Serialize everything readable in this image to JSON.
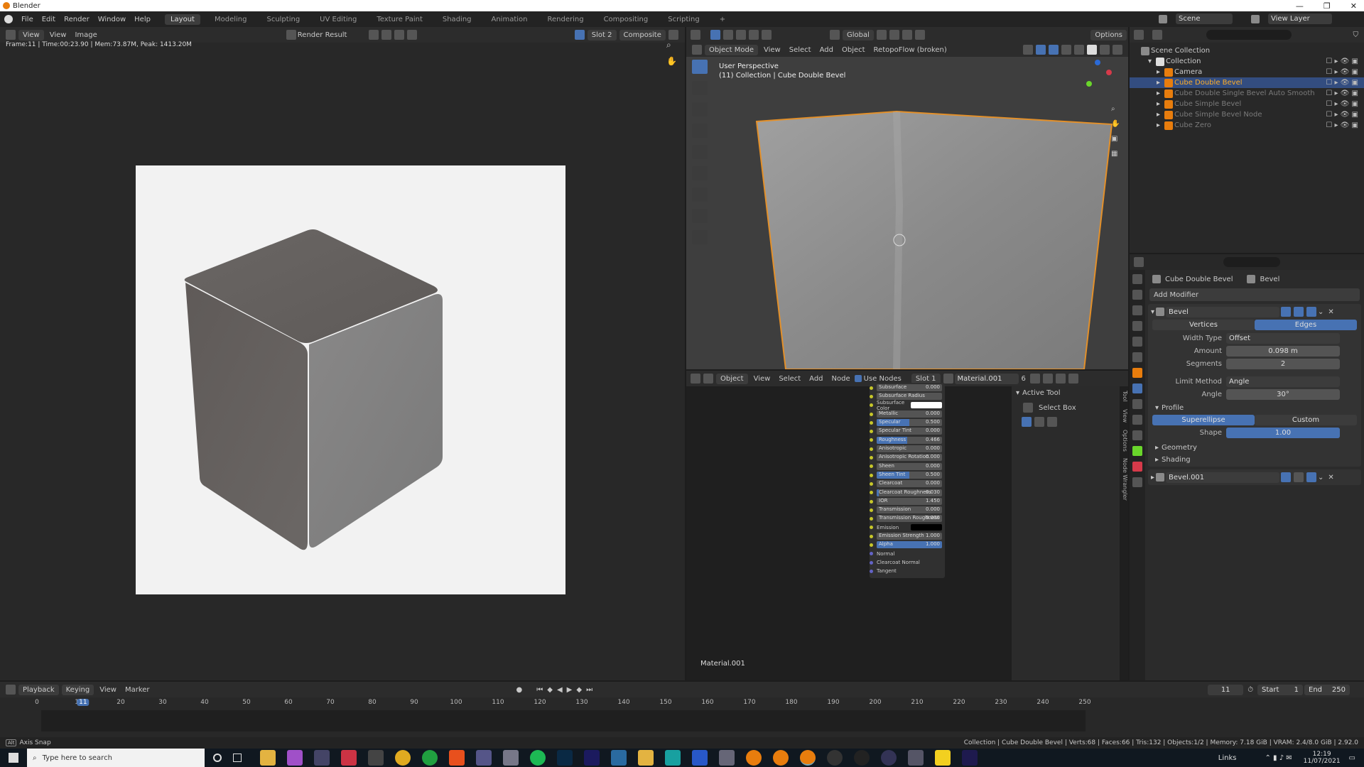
{
  "window": {
    "title": "Blender"
  },
  "menus": [
    "File",
    "Edit",
    "Render",
    "Window",
    "Help"
  ],
  "workspaces": [
    "Layout",
    "Modeling",
    "Sculpting",
    "UV Editing",
    "Texture Paint",
    "Shading",
    "Animation",
    "Rendering",
    "Compositing",
    "Scripting"
  ],
  "top_right": {
    "scene": "Scene",
    "view_layer": "View Layer"
  },
  "image_editor": {
    "view": "View",
    "view2": "View",
    "image": "Image",
    "image_name": "Render Result",
    "slot": "Slot 2",
    "composite": "Composite",
    "stats": "Frame:11 | Time:00:23.90 | Mem:73.87M, Peak: 1413.20M"
  },
  "viewport": {
    "mode": "Object Mode",
    "menu": [
      "View",
      "Select",
      "Add",
      "Object"
    ],
    "retopo": "RetopoFlow (broken)",
    "orientation": "Global",
    "options": "Options",
    "persp": "User Perspective",
    "collection_info": "(11) Collection | Cube Double Bevel"
  },
  "node_editor": {
    "object": "Object",
    "menu": [
      "View",
      "Select",
      "Add",
      "Node"
    ],
    "use_nodes": "Use Nodes",
    "slot": "Slot 1",
    "material": "Material.001",
    "users": "6",
    "material_label": "Material.001"
  },
  "node_rows": [
    {
      "name": "Subsurface",
      "value": "0.000",
      "fill": 0
    },
    {
      "name": "Subsurface Radius",
      "value": "",
      "fill": 0,
      "dropdown": true
    },
    {
      "name": "Subsurface Color",
      "value": "",
      "color": "#ffffff"
    },
    {
      "name": "Metallic",
      "value": "0.000",
      "fill": 0
    },
    {
      "name": "Specular",
      "value": "0.500",
      "fill": 0.5
    },
    {
      "name": "Specular Tint",
      "value": "0.000",
      "fill": 0
    },
    {
      "name": "Roughness",
      "value": "0.466",
      "fill": 0.466
    },
    {
      "name": "Anisotropic",
      "value": "0.000",
      "fill": 0
    },
    {
      "name": "Anisotropic Rotation",
      "value": "0.000",
      "fill": 0
    },
    {
      "name": "Sheen",
      "value": "0.000",
      "fill": 0
    },
    {
      "name": "Sheen Tint",
      "value": "0.500",
      "fill": 0.5
    },
    {
      "name": "Clearcoat",
      "value": "0.000",
      "fill": 0
    },
    {
      "name": "Clearcoat Roughness",
      "value": "0.030",
      "fill": 0.03
    },
    {
      "name": "IOR",
      "value": "1.450",
      "fill": 0
    },
    {
      "name": "Transmission",
      "value": "0.000",
      "fill": 0
    },
    {
      "name": "Transmission Roughness",
      "value": "0.000",
      "fill": 0
    },
    {
      "name": "Emission",
      "value": "",
      "color": "#000000"
    },
    {
      "name": "Emission Strength",
      "value": "1.000",
      "fill": 0
    },
    {
      "name": "Alpha",
      "value": "1.000",
      "fill": 1
    },
    {
      "name": "Normal",
      "value": "",
      "plain": true
    },
    {
      "name": "Clearcoat Normal",
      "value": "",
      "plain": true
    },
    {
      "name": "Tangent",
      "value": "",
      "plain": true
    }
  ],
  "sidebar": {
    "active_tool": "Active Tool",
    "select_box": "Select Box",
    "tabs": [
      "Tool",
      "View",
      "Options",
      "Node Wrangler"
    ]
  },
  "outliner": {
    "root": "Scene Collection",
    "items": [
      {
        "name": "Collection",
        "indent": 1
      },
      {
        "name": "Camera",
        "indent": 2
      },
      {
        "name": "Cube Double Bevel",
        "indent": 2,
        "selected": true
      },
      {
        "name": "Cube Double Single Bevel Auto Smooth",
        "indent": 2,
        "dim": true
      },
      {
        "name": "Cube Simple Bevel",
        "indent": 2,
        "dim": true
      },
      {
        "name": "Cube Simple Bevel Node",
        "indent": 2,
        "dim": true
      },
      {
        "name": "Cube Zero",
        "indent": 2,
        "dim": true
      }
    ]
  },
  "properties": {
    "object": "Cube Double Bevel",
    "modifier_icon": "Bevel",
    "add_modifier": "Add Modifier",
    "mod1": "Bevel",
    "vertices": "Vertices",
    "edges": "Edges",
    "width_type_label": "Width Type",
    "width_type": "Offset",
    "amount_label": "Amount",
    "amount": "0.098 m",
    "segments_label": "Segments",
    "segments": "2",
    "limit_method_label": "Limit Method",
    "limit_method": "Angle",
    "angle_label": "Angle",
    "angle": "30°",
    "profile": "Profile",
    "superellipse": "Superellipse",
    "custom": "Custom",
    "shape_label": "Shape",
    "shape": "1.00",
    "shape_fill": 1.0,
    "geometry": "Geometry",
    "shading": "Shading",
    "mod2": "Bevel.001"
  },
  "timeline": {
    "menu": [
      "Playback",
      "Keying",
      "View",
      "Marker"
    ],
    "current": "11",
    "start_label": "Start",
    "start": "1",
    "end_label": "End",
    "end": "250",
    "ticks": [
      "0",
      "10",
      "20",
      "30",
      "40",
      "50",
      "60",
      "70",
      "80",
      "90",
      "100",
      "110",
      "120",
      "130",
      "140",
      "150",
      "160",
      "170",
      "180",
      "190",
      "200",
      "210",
      "220",
      "230",
      "240",
      "250"
    ]
  },
  "statusbar": {
    "left": "Axis Snap",
    "right": "Collection | Cube Double Bevel | Verts:68 | Faces:66 | Tris:132 | Objects:1/2 | Memory: 7.18 GiB | VRAM: 2.4/8.0 GiB | 2.92.0"
  },
  "taskbar": {
    "search": "Type here to search",
    "links": "Links",
    "time": "12:19",
    "date": "11/07/2021"
  }
}
